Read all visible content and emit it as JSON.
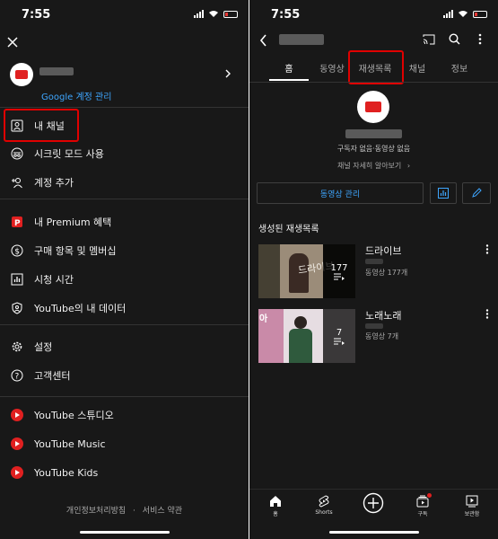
{
  "status": {
    "time": "7:55"
  },
  "left": {
    "manage_account": "Google 계정 관리",
    "menu": [
      {
        "label": "내 채널",
        "icon": "person-box-icon"
      },
      {
        "label": "시크릿 모드 사용",
        "icon": "incognito-icon"
      },
      {
        "label": "계정 추가",
        "icon": "add-person-icon"
      },
      {
        "label": "내 Premium 혜택",
        "icon": "premium-icon"
      },
      {
        "label": "구매 항목 및 멤버십",
        "icon": "dollar-icon"
      },
      {
        "label": "시청 시간",
        "icon": "bar-chart-icon"
      },
      {
        "label": "YouTube의 내 데이터",
        "icon": "shield-person-icon"
      },
      {
        "label": "설정",
        "icon": "gear-icon"
      },
      {
        "label": "고객센터",
        "icon": "help-icon"
      },
      {
        "label": "YouTube 스튜디오",
        "icon": "youtube-studio-icon"
      },
      {
        "label": "YouTube Music",
        "icon": "youtube-music-icon"
      },
      {
        "label": "YouTube Kids",
        "icon": "youtube-kids-icon"
      }
    ],
    "footer": {
      "privacy": "개인정보처리방침",
      "dot": "·",
      "terms": "서비스 약관"
    }
  },
  "right": {
    "tabs": [
      "홈",
      "동영상",
      "재생목록",
      "채널",
      "정보"
    ],
    "subscriber_info": "구독자 없음·동영상 없음",
    "channel_more": "채널 자세히 알아보기",
    "manage_videos": "동영상 관리",
    "section_title": "생성된 재생목록",
    "playlists": [
      {
        "title": "드라이브",
        "count": "177",
        "sub": "동영상 177개",
        "thumb_text": "드라이브"
      },
      {
        "title": "노래노래",
        "count": "7",
        "sub": "동영상 7개",
        "thumb_text": "아"
      }
    ],
    "nav": [
      {
        "label": "홈",
        "icon": "home-icon"
      },
      {
        "label": "Shorts",
        "icon": "shorts-icon"
      },
      {
        "label": "",
        "icon": "add-circle-icon"
      },
      {
        "label": "구독",
        "icon": "subscriptions-icon"
      },
      {
        "label": "보관함",
        "icon": "library-icon"
      }
    ]
  }
}
